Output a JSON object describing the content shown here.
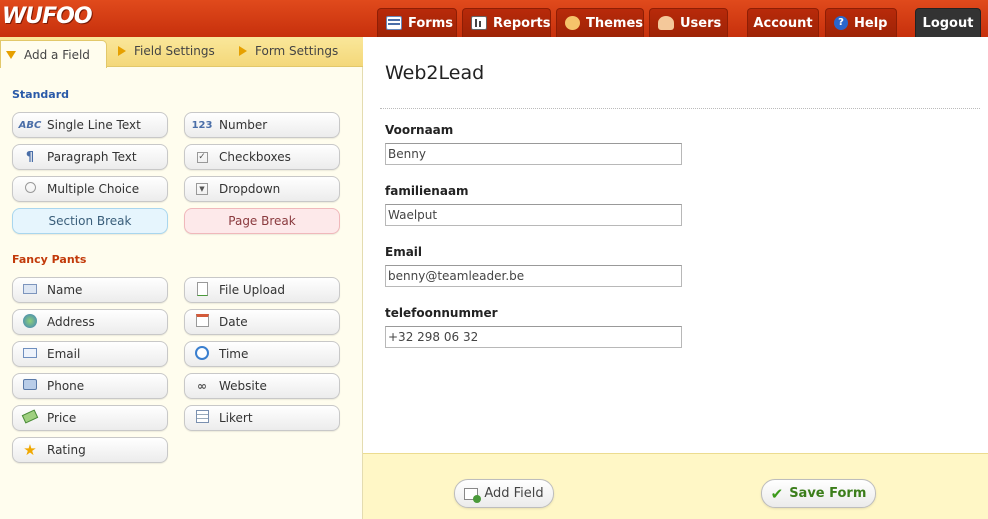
{
  "app": {
    "logo": "WUFOO"
  },
  "nav": {
    "forms": "Forms",
    "reports": "Reports",
    "themes": "Themes",
    "users": "Users",
    "account": "Account",
    "help": "Help",
    "logout": "Logout"
  },
  "sidebar": {
    "tabs": [
      "Add a Field",
      "Field Settings",
      "Form Settings"
    ],
    "standard_title": "Standard",
    "standard": [
      "Single Line Text",
      "Number",
      "Paragraph Text",
      "Checkboxes",
      "Multiple Choice",
      "Dropdown",
      "Section Break",
      "Page Break"
    ],
    "fancy_title": "Fancy Pants",
    "fancy": [
      "Name",
      "File Upload",
      "Address",
      "Date",
      "Email",
      "Time",
      "Phone",
      "Website",
      "Price",
      "Likert",
      "Rating"
    ]
  },
  "form": {
    "title": "Web2Lead",
    "fields": [
      {
        "label": "Voornaam",
        "value": "Benny"
      },
      {
        "label": "familienaam",
        "value": "Waelput"
      },
      {
        "label": "Email",
        "value": "benny@teamleader.be"
      },
      {
        "label": "telefoonnummer",
        "value": "+32 298 06 32"
      }
    ]
  },
  "footer": {
    "add_field": "Add Field",
    "save_form": "Save Form"
  },
  "colors": {
    "brand": "#d43d12",
    "standard_title": "#2a5aa8",
    "fancy_title": "#c23a0a",
    "save": "#3b7d1a"
  }
}
